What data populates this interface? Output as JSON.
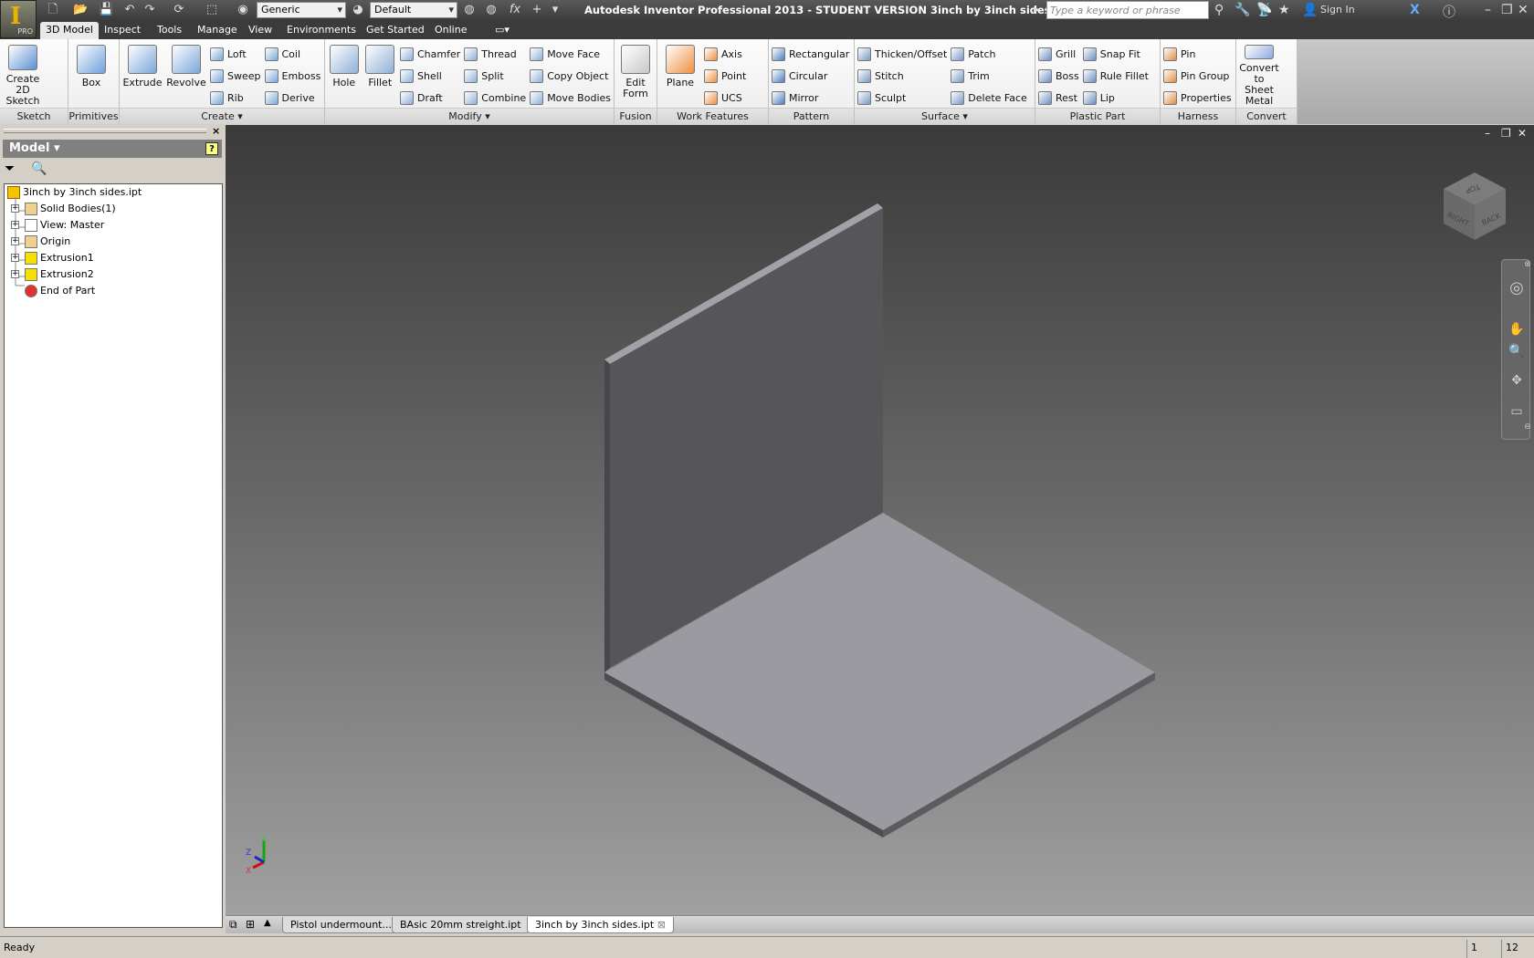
{
  "app": {
    "title": "Autodesk Inventor Professional 2013 - STUDENT VERSION    3inch by 3inch sides.ipt",
    "badge": "PRO",
    "letter": "I"
  },
  "quick_access": {
    "material": "Generic",
    "appearance": "Default",
    "search_placeholder": "Type a keyword or phrase",
    "sign_in": "Sign In"
  },
  "tabs": [
    "3D Model",
    "Inspect",
    "Tools",
    "Manage",
    "View",
    "Environments",
    "Get Started",
    "Online"
  ],
  "active_tab": "3D Model",
  "ribbon": [
    {
      "label": "Sketch",
      "groups": [
        {
          "type": "large",
          "items": [
            "Create 2D Sketch"
          ]
        }
      ]
    },
    {
      "label": "Primitives",
      "groups": [
        {
          "type": "large",
          "items": [
            "Box"
          ]
        }
      ]
    },
    {
      "label": "Create ▾",
      "groups": [
        {
          "type": "large",
          "items": [
            "Extrude"
          ]
        },
        {
          "type": "large",
          "items": [
            "Revolve"
          ]
        },
        {
          "type": "col",
          "items": [
            "Loft",
            "Sweep",
            "Rib"
          ]
        },
        {
          "type": "col",
          "items": [
            "Coil",
            "Emboss",
            "Derive"
          ]
        }
      ]
    },
    {
      "label": "Modify ▾",
      "groups": [
        {
          "type": "large",
          "items": [
            "Hole"
          ]
        },
        {
          "type": "large",
          "items": [
            "Fillet"
          ]
        },
        {
          "type": "col",
          "items": [
            "Chamfer",
            "Shell",
            "Draft"
          ]
        },
        {
          "type": "col",
          "items": [
            "Thread",
            "Split",
            "Combine"
          ]
        },
        {
          "type": "col",
          "items": [
            "Move Face",
            "Copy Object",
            "Move Bodies"
          ]
        }
      ]
    },
    {
      "label": "Fusion",
      "groups": [
        {
          "type": "large",
          "items": [
            "Edit Form"
          ]
        }
      ]
    },
    {
      "label": "Work Features",
      "groups": [
        {
          "type": "large",
          "items": [
            "Plane"
          ]
        },
        {
          "type": "col",
          "items": [
            "Axis",
            "Point",
            "UCS"
          ]
        }
      ]
    },
    {
      "label": "Pattern",
      "groups": [
        {
          "type": "col",
          "items": [
            "Rectangular",
            "Circular",
            "Mirror"
          ]
        }
      ]
    },
    {
      "label": "Surface ▾",
      "groups": [
        {
          "type": "col",
          "items": [
            "Thicken/Offset",
            "Stitch",
            "Sculpt"
          ]
        },
        {
          "type": "col",
          "items": [
            "Patch",
            "Trim",
            "Delete Face"
          ]
        }
      ]
    },
    {
      "label": "Plastic Part",
      "groups": [
        {
          "type": "col",
          "items": [
            "Grill",
            "Boss",
            "Rest"
          ]
        },
        {
          "type": "col",
          "items": [
            "Snap Fit",
            "Rule Fillet",
            "Lip"
          ]
        }
      ]
    },
    {
      "label": "Harness",
      "groups": [
        {
          "type": "col",
          "items": [
            "Pin",
            "Pin Group",
            "Properties"
          ]
        }
      ]
    },
    {
      "label": "Convert",
      "groups": [
        {
          "type": "large",
          "items": [
            "Convert to Sheet Metal"
          ]
        }
      ]
    }
  ],
  "browser": {
    "title": "Model ▾",
    "help": "?",
    "root": "3inch by 3inch sides.ipt",
    "nodes": [
      {
        "label": "Solid Bodies(1)",
        "icon": "folder-bodies"
      },
      {
        "label": "View: Master",
        "icon": "view"
      },
      {
        "label": "Origin",
        "icon": "folder"
      },
      {
        "label": "Extrusion1",
        "icon": "extrusion"
      },
      {
        "label": "Extrusion2",
        "icon": "extrusion"
      },
      {
        "label": "End of Part",
        "icon": "end-of-part"
      }
    ]
  },
  "viewcube": {
    "faces": [
      "TOP",
      "RIGHT",
      "BACK"
    ]
  },
  "triad": {
    "x": "X",
    "y": "Y",
    "z": "Z"
  },
  "doc_tabs": [
    {
      "label": "Pistol undermount...iam"
    },
    {
      "label": "BAsic 20mm streight.ipt"
    },
    {
      "label": "3inch by 3inch sides.ipt",
      "active": true
    }
  ],
  "status": {
    "text": "Ready",
    "field1": "1",
    "field2": "12"
  },
  "colors": {
    "model_wall": "#56555a",
    "model_floor": "#9b9aa0",
    "accent": "#e8b400"
  }
}
